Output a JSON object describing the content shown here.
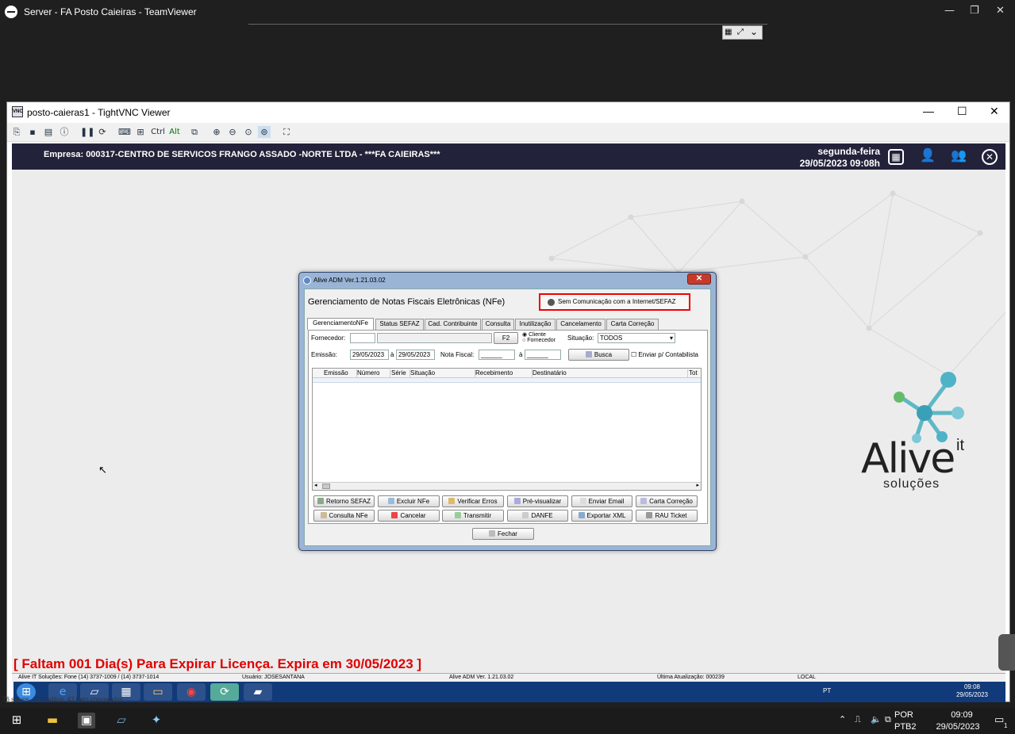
{
  "teamviewer": {
    "title": "Server - FA Posto Caieiras - TeamViewer"
  },
  "vnc": {
    "title": "posto-caieras1 - TightVNC Viewer",
    "toolbar": [
      "Ctrl",
      "Alt"
    ]
  },
  "app_header": {
    "empresa": "Empresa: 000317-CENTRO DE SERVICOS FRANGO ASSADO -NORTE LTDA - ***FA CAIEIRAS***",
    "day": "segunda-feira",
    "datetime": "29/05/2023 09:08h"
  },
  "logo": {
    "brand": "Alive",
    "suffix": "it",
    "tagline": "soluções"
  },
  "license_warning": "[ Faltam 001 Dia(s) Para Expirar Licença. Expira em 30/05/2023 ]",
  "status_bar": {
    "company": "Alive IT Soluções: Fone (14) 3737-1009 / (14) 3737-1014",
    "user": "Usuário: JOSESANTANA",
    "version": "Alive ADM Ver. 1.21.03.02",
    "last_update": "Última Atualização: 000239",
    "location": "LOCAL"
  },
  "dialog": {
    "window_title": "Alive ADM Ver.1.21.03.02",
    "heading": "Gerenciamento de Notas Fiscais Eletrônicas (NFe)",
    "sefaz_status": "Sem Comunicação com a Internet/SEFAZ",
    "tabs": [
      "GerenciamentoNFe",
      "Status SEFAZ",
      "Cad. Contribuinte",
      "Consulta",
      "Inutilização",
      "Cancelamento",
      "Carta Correção"
    ],
    "filters": {
      "fornecedor_label": "Fornecedor:",
      "f2_label": "F2",
      "cliente_label": "Cliente",
      "fornecedor_radio_label": "Fornecedor",
      "situacao_label": "Situação:",
      "situacao_value": "TODOS",
      "emissao_label": "Emissão:",
      "date_from": "29/05/2023",
      "a_label": "à",
      "date_to": "29/05/2023",
      "nota_label": "Nota Fiscal:",
      "nota_from": "______",
      "nota_to": "______",
      "busca_label": "Busca",
      "contab_label": "Enviar p/ Contabilista"
    },
    "grid_columns": [
      "Emissão",
      "Número",
      "Série",
      "Situação",
      "Recebimento",
      "Destinatário",
      "Tot"
    ],
    "buttons_row1": [
      "Retorno SEFAZ",
      "Excluir NFe",
      "Verificar Erros",
      "Pré-visualizar",
      "Enviar Email",
      "Carta Correção"
    ],
    "buttons_row2": [
      "Consulta NFe",
      "Cancelar",
      "Transmitir",
      "DANFE",
      "Exportar XML",
      "RAU Ticket"
    ],
    "close_label": "Fechar"
  },
  "inner_taskbar": {
    "lang": "PT",
    "time": "09:08",
    "date": "29/05/2023"
  },
  "os_taskbar": {
    "lang1": "POR",
    "lang2": "PTB2",
    "time": "09:09",
    "date": "29/05/2023",
    "notif_count": "1"
  },
  "bottom_clip": "76 salvos, 22 ineditos, 43 Fato convertidos"
}
